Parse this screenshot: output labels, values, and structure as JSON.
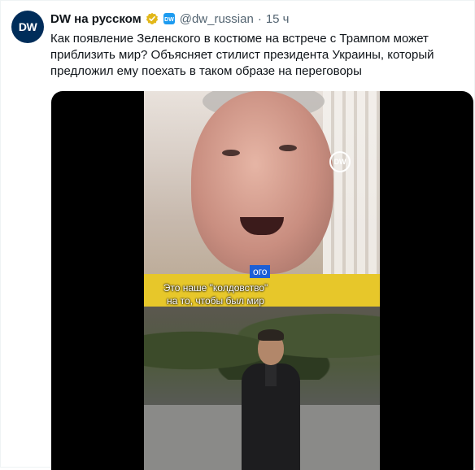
{
  "author": {
    "avatar_label": "DW",
    "name": "DW на русском",
    "handle": "@dw_russian",
    "separator": "·",
    "time": "15 ч"
  },
  "tweet": {
    "text": "Как появление Зеленского в костюме на встрече с Трампом может приблизить мир? Объясняет стилист президента Украины, который предложил ему поехать в таком образе на переговоры"
  },
  "video": {
    "watermark": "DW",
    "overlay_tag": "ого",
    "subtitle_line1": "Это наше \"колдовство\"",
    "subtitle_line2": "на то, чтобы был мир"
  },
  "colors": {
    "verified_badge": "#e2b719",
    "affiliate_badge": "#1d9bf0",
    "avatar_bg": "#002d5a",
    "meta_text": "#536471"
  },
  "icons": [
    "verified-badge-icon",
    "affiliate-badge-icon"
  ]
}
